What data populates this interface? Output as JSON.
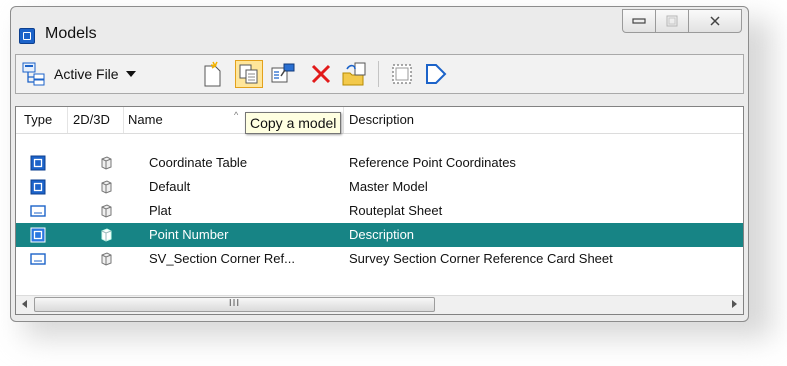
{
  "window": {
    "title": "Models",
    "buttons": {
      "minimize": "▭",
      "maximize": "□",
      "close": "X"
    }
  },
  "toolbar": {
    "active_file_label": "Active File",
    "icons": [
      "hierarchy-icon",
      "new-model-icon",
      "copy-model-icon",
      "model-properties-icon",
      "delete-icon",
      "import-icon",
      "select-all-icon",
      "dgn-shape-icon"
    ]
  },
  "tooltip": {
    "text": "Copy a model"
  },
  "list": {
    "columns": [
      "Type",
      "2D/3D",
      "Name",
      "Description"
    ],
    "sort_indicator": "^",
    "rows": [
      {
        "type_icon": "model-icon",
        "dim_icon": "3d-cube-icon",
        "name": "Coordinate Table",
        "description": "Reference Point Coordinates",
        "selected": false
      },
      {
        "type_icon": "model-icon",
        "dim_icon": "3d-cube-icon",
        "name": "Default",
        "description": "Master Model",
        "selected": false
      },
      {
        "type_icon": "sheet-icon",
        "dim_icon": "3d-cube-icon",
        "name": "Plat",
        "description": "Routeplat Sheet",
        "selected": false
      },
      {
        "type_icon": "model-icon",
        "dim_icon": "3d-cube-icon",
        "name": "Point Number",
        "description": "Description",
        "selected": true
      },
      {
        "type_icon": "sheet-icon",
        "dim_icon": "3d-cube-icon",
        "name": "SV_Section Corner Ref...",
        "description": "Survey Section Corner Reference Card Sheet",
        "selected": false
      }
    ]
  },
  "scrollbar": {
    "thumb_grip": "III"
  },
  "colors": {
    "selection": "#178485",
    "accent_blue": "#1c63c9",
    "hover": "#ffe69a"
  }
}
